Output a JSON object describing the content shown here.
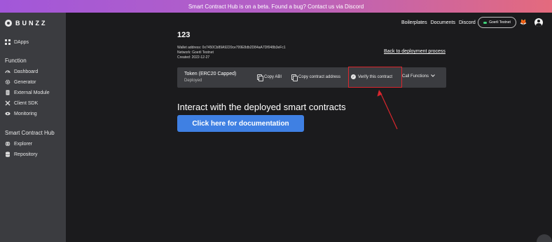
{
  "banner": {
    "text": "Smart Contract Hub is on a beta. Found a bug? Contact us via Discord"
  },
  "brand": {
    "logo_text": "BUNZZ"
  },
  "sidebar": {
    "dapps": "DApps",
    "function_title": "Function",
    "function_items": [
      {
        "label": "Dashboard",
        "icon": "dashboard-icon"
      },
      {
        "label": "Generator",
        "icon": "gear-icon"
      },
      {
        "label": "External Module",
        "icon": "document-icon"
      },
      {
        "label": "Client SDK",
        "icon": "tools-icon"
      },
      {
        "label": "Monitoring",
        "icon": "eye-icon"
      }
    ],
    "hub_title": "Smart Contract Hub",
    "hub_items": [
      {
        "label": "Explorer",
        "icon": "globe-icon"
      },
      {
        "label": "Repository",
        "icon": "database-icon"
      }
    ]
  },
  "topnav": {
    "links": [
      "Boilerplates",
      "Documents",
      "Discord"
    ],
    "network": "Goerli Testnet",
    "network_color": "#3fd37a"
  },
  "contract": {
    "name": "123",
    "wallet_address": "Wallet address: 0x7450Cb89A9220ce799E8db2D84aA7Df048b3eFc1",
    "network": "Network: Goerli Testnet",
    "created": "Created: 2022-12-27",
    "back_link": "Back to deployment process"
  },
  "card": {
    "title": "Token (ERC20 Capped)",
    "status": "Deployed",
    "copy_abi": "Copy ABI",
    "copy_address": "Copy contract address",
    "verify": "Verify this contract",
    "call_functions": "Call Functions"
  },
  "main": {
    "interact_heading": "Interact with the deployed smart contracts",
    "doc_button": "Click here for documentation"
  },
  "colors": {
    "highlight": "#d9262d",
    "button": "#3f80e3",
    "sidebar": "#3b3c40",
    "background": "#1b1b1d"
  }
}
